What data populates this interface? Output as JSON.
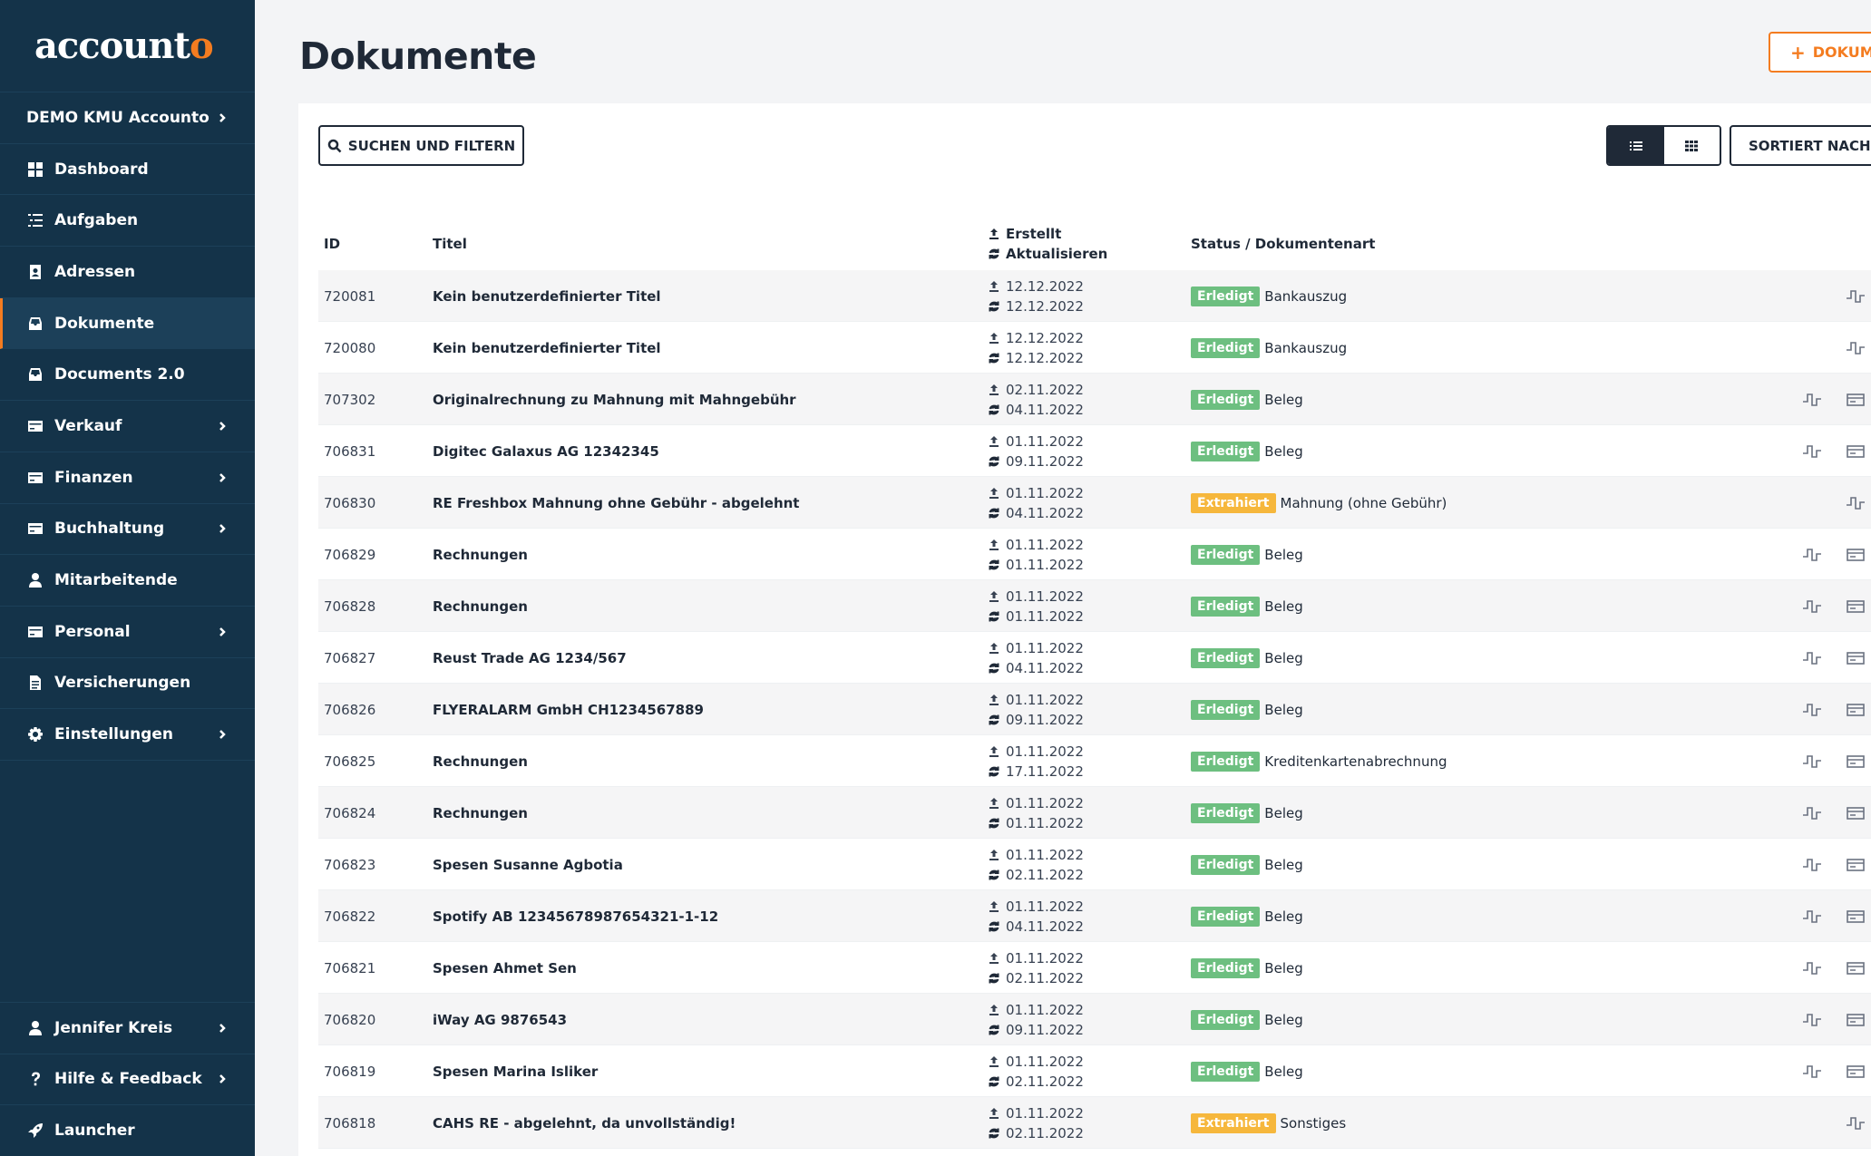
{
  "app": {
    "logo_main": "account",
    "logo_accent": "o"
  },
  "sidebar": {
    "company": "DEMO KMU Accounto",
    "items": [
      {
        "label": "Dashboard",
        "icon": "dashboard-icon",
        "chevron": false
      },
      {
        "label": "Aufgaben",
        "icon": "tasks-icon",
        "chevron": false
      },
      {
        "label": "Adressen",
        "icon": "address-book-icon",
        "chevron": false
      },
      {
        "label": "Dokumente",
        "icon": "inbox-icon",
        "chevron": false,
        "active": true
      },
      {
        "label": "Documents 2.0",
        "icon": "inbox-icon",
        "chevron": false
      },
      {
        "label": "Verkauf",
        "icon": "card-icon",
        "chevron": true
      },
      {
        "label": "Finanzen",
        "icon": "card-icon",
        "chevron": true
      },
      {
        "label": "Buchhaltung",
        "icon": "card-icon",
        "chevron": true
      },
      {
        "label": "Mitarbeitende",
        "icon": "user-icon",
        "chevron": false
      },
      {
        "label": "Personal",
        "icon": "card-icon",
        "chevron": true
      },
      {
        "label": "Versicherungen",
        "icon": "document-icon",
        "chevron": false
      },
      {
        "label": "Einstellungen",
        "icon": "gear-icon",
        "chevron": true
      }
    ],
    "bottom": [
      {
        "label": "Jennifer Kreis",
        "icon": "user-icon",
        "chevron": true
      },
      {
        "label": "Hilfe & Feedback",
        "icon": "question-icon",
        "chevron": true
      },
      {
        "label": "Launcher",
        "icon": "rocket-icon",
        "chevron": false
      }
    ]
  },
  "header": {
    "title": "Dokumente",
    "add_button": "DOKUME"
  },
  "toolbar": {
    "search_label": "SUCHEN UND FILTERN",
    "sort_label": "SORTIERT NACH ID",
    "view_mode": "list"
  },
  "table": {
    "headers": {
      "id": "ID",
      "title": "Titel",
      "created": "Erstellt",
      "updated": "Aktualisieren",
      "status": "Status / Dokumentenart"
    },
    "rows": [
      {
        "id": "720081",
        "title": "Kein benutzerdefinierter Titel",
        "created": "12.12.2022",
        "updated": "12.12.2022",
        "status": "Erledigt",
        "status_type": "done",
        "doc_type": "Bankauszug",
        "second_action": false
      },
      {
        "id": "720080",
        "title": "Kein benutzerdefinierter Titel",
        "created": "12.12.2022",
        "updated": "12.12.2022",
        "status": "Erledigt",
        "status_type": "done",
        "doc_type": "Bankauszug",
        "second_action": false
      },
      {
        "id": "707302",
        "title": "Originalrechnung zu Mahnung mit Mahngebühr",
        "created": "02.11.2022",
        "updated": "04.11.2022",
        "status": "Erledigt",
        "status_type": "done",
        "doc_type": "Beleg",
        "second_action": true
      },
      {
        "id": "706831",
        "title": "Digitec Galaxus AG 12342345",
        "created": "01.11.2022",
        "updated": "09.11.2022",
        "status": "Erledigt",
        "status_type": "done",
        "doc_type": "Beleg",
        "second_action": true
      },
      {
        "id": "706830",
        "title": "RE Freshbox Mahnung ohne Gebühr - abgelehnt",
        "created": "01.11.2022",
        "updated": "04.11.2022",
        "status": "Extrahiert",
        "status_type": "extracted",
        "doc_type": "Mahnung (ohne Gebühr)",
        "second_action": false
      },
      {
        "id": "706829",
        "title": "Rechnungen",
        "created": "01.11.2022",
        "updated": "01.11.2022",
        "status": "Erledigt",
        "status_type": "done",
        "doc_type": "Beleg",
        "second_action": true
      },
      {
        "id": "706828",
        "title": "Rechnungen",
        "created": "01.11.2022",
        "updated": "01.11.2022",
        "status": "Erledigt",
        "status_type": "done",
        "doc_type": "Beleg",
        "second_action": true
      },
      {
        "id": "706827",
        "title": "Reust Trade AG 1234/567",
        "created": "01.11.2022",
        "updated": "04.11.2022",
        "status": "Erledigt",
        "status_type": "done",
        "doc_type": "Beleg",
        "second_action": true
      },
      {
        "id": "706826",
        "title": "FLYERALARM GmbH CH1234567889",
        "created": "01.11.2022",
        "updated": "09.11.2022",
        "status": "Erledigt",
        "status_type": "done",
        "doc_type": "Beleg",
        "second_action": true
      },
      {
        "id": "706825",
        "title": "Rechnungen",
        "created": "01.11.2022",
        "updated": "17.11.2022",
        "status": "Erledigt",
        "status_type": "done",
        "doc_type": "Kreditenkartenabrechnung",
        "second_action": true
      },
      {
        "id": "706824",
        "title": "Rechnungen",
        "created": "01.11.2022",
        "updated": "01.11.2022",
        "status": "Erledigt",
        "status_type": "done",
        "doc_type": "Beleg",
        "second_action": true
      },
      {
        "id": "706823",
        "title": "Spesen Susanne Agbotia",
        "created": "01.11.2022",
        "updated": "02.11.2022",
        "status": "Erledigt",
        "status_type": "done",
        "doc_type": "Beleg",
        "second_action": true
      },
      {
        "id": "706822",
        "title": "Spotify AB 12345678987654321-1-12",
        "created": "01.11.2022",
        "updated": "04.11.2022",
        "status": "Erledigt",
        "status_type": "done",
        "doc_type": "Beleg",
        "second_action": true
      },
      {
        "id": "706821",
        "title": "Spesen Ahmet Sen",
        "created": "01.11.2022",
        "updated": "02.11.2022",
        "status": "Erledigt",
        "status_type": "done",
        "doc_type": "Beleg",
        "second_action": true
      },
      {
        "id": "706820",
        "title": "iWay AG 9876543",
        "created": "01.11.2022",
        "updated": "09.11.2022",
        "status": "Erledigt",
        "status_type": "done",
        "doc_type": "Beleg",
        "second_action": true
      },
      {
        "id": "706819",
        "title": "Spesen Marina Isliker",
        "created": "01.11.2022",
        "updated": "02.11.2022",
        "status": "Erledigt",
        "status_type": "done",
        "doc_type": "Beleg",
        "second_action": true
      },
      {
        "id": "706818",
        "title": "CAHS RE - abgelehnt, da unvollständig!",
        "created": "01.11.2022",
        "updated": "02.11.2022",
        "status": "Extrahiert",
        "status_type": "extracted",
        "doc_type": "Sonstiges",
        "second_action": false
      }
    ]
  },
  "colors": {
    "sidebar_bg": "#143349",
    "accent": "#f47c20",
    "done": "#6dbf80",
    "extracted": "#f6b73c"
  }
}
